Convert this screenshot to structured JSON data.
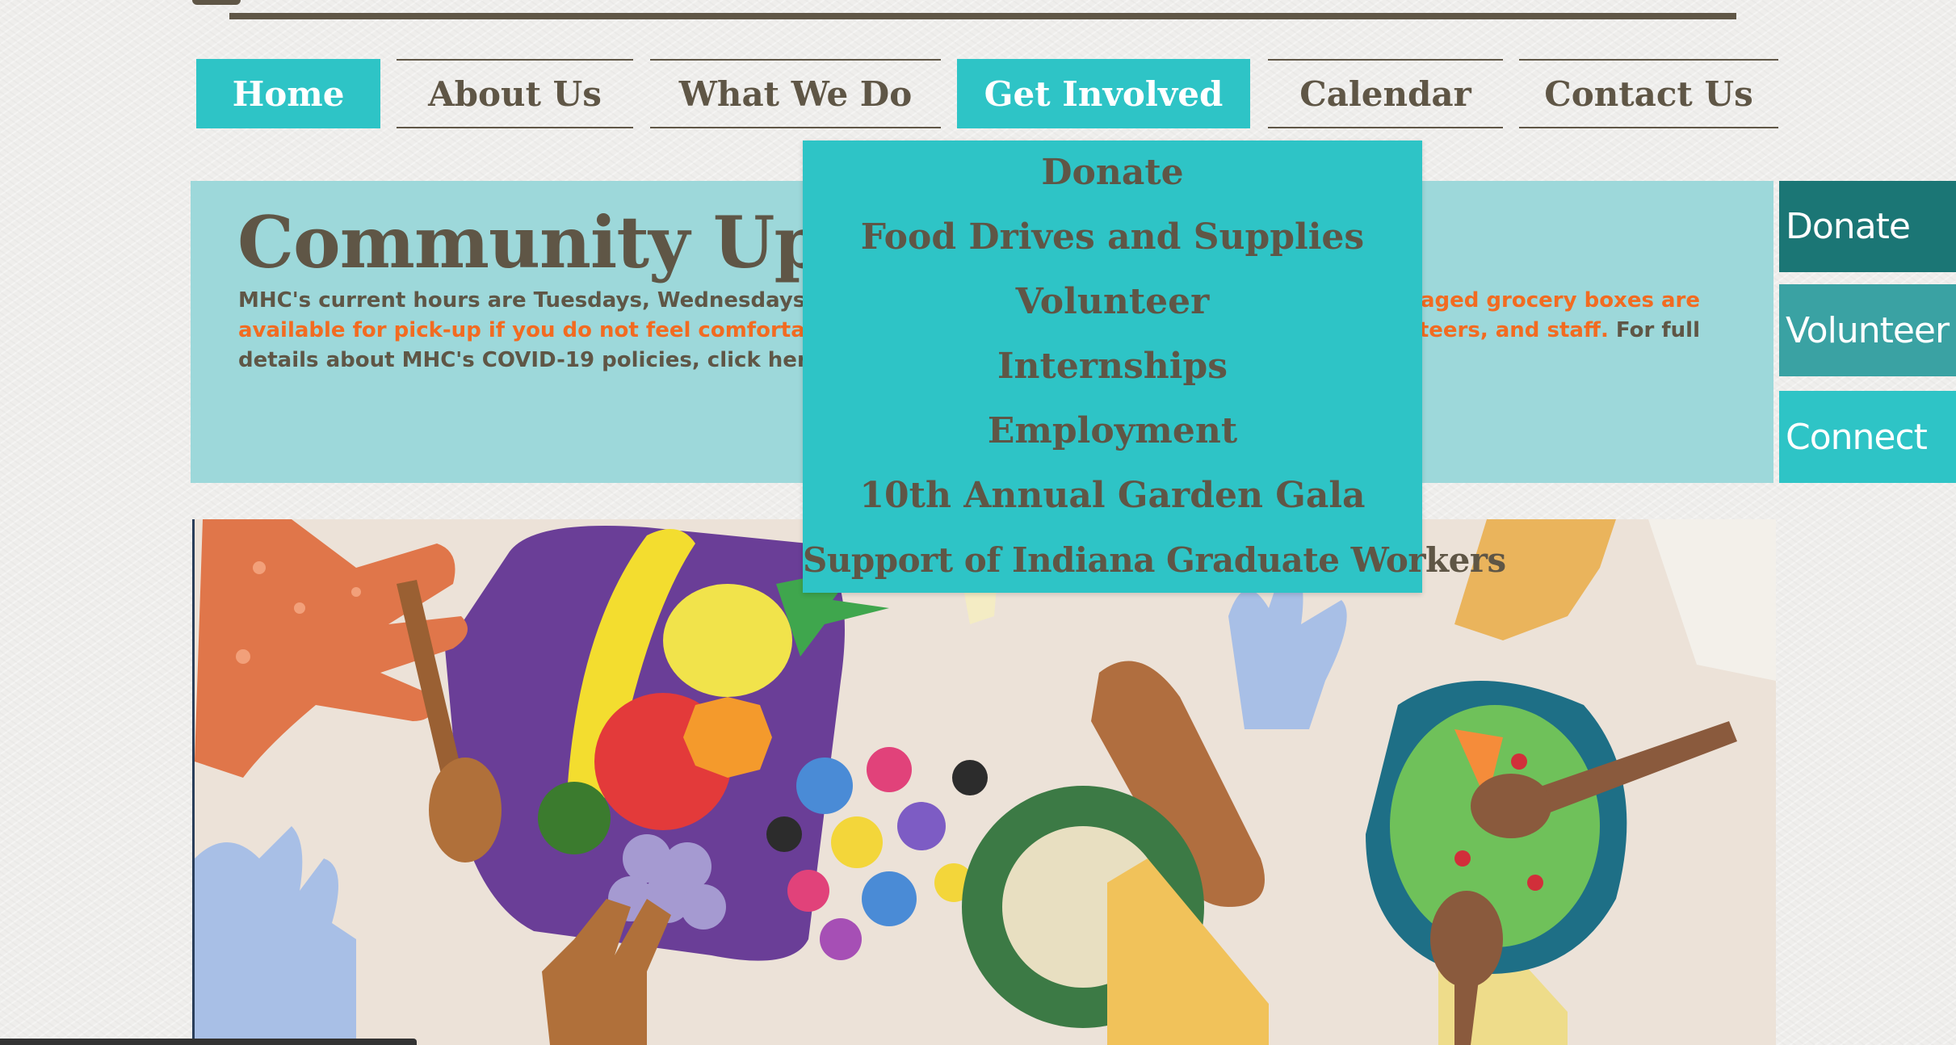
{
  "nav": {
    "items": [
      {
        "label": "Home",
        "active": true
      },
      {
        "label": "About Us",
        "active": false
      },
      {
        "label": "What We Do",
        "active": false
      },
      {
        "label": "Get Involved",
        "active": true
      },
      {
        "label": "Calendar",
        "active": false
      },
      {
        "label": "Contact Us",
        "active": false
      }
    ]
  },
  "dropdown": {
    "parent": "Get Involved",
    "items": [
      "Donate",
      "Food Drives and Supplies",
      "Volunteer",
      "Internships",
      "Employment",
      "10th Annual Garden Gala",
      "Support of Indiana Graduate Workers"
    ]
  },
  "update": {
    "title": "Community Upda",
    "text_1": "MHC's current hours are Tuesdays, Wednesdays, Thursdays",
    "orange_1": "-packaged grocery boxes are",
    "orange_2": "available for pick-up if you do not feel comfortable indoor",
    "orange_3": "olunteers, and staff.",
    "text_2": " For full",
    "text_3": "details about MHC's COVID-19 policies, click here."
  },
  "side_buttons": [
    {
      "label": "Donate",
      "color": "#1b7675"
    },
    {
      "label": "Volunteer",
      "color": "#3aa2a3"
    },
    {
      "label": "Connect",
      "color": "#2ec4c6"
    }
  ],
  "colors": {
    "accent": "#2ec4c6",
    "text": "#5f5646",
    "panel": "#9dd8da",
    "orange": "#f26b21"
  }
}
